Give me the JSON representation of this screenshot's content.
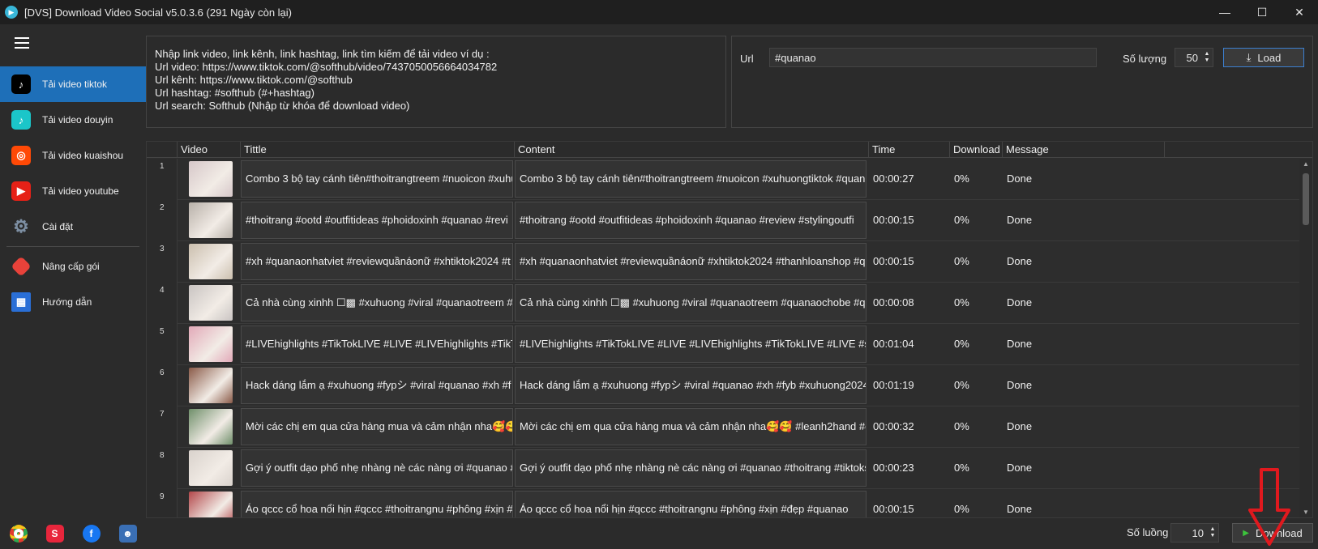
{
  "window": {
    "title": "[DVS] Download Video Social v5.0.3.6 (291 Ngày còn lại)"
  },
  "sidebar": {
    "items": [
      {
        "label": "Tải video tiktok",
        "icon": "tiktok-icon",
        "color": "#000000",
        "active": true
      },
      {
        "label": "Tải video douyin",
        "icon": "douyin-icon",
        "color": "#1bc6c9",
        "active": false
      },
      {
        "label": "Tải video kuaishou",
        "icon": "kuaishou-icon",
        "color": "#ff4906",
        "active": false
      },
      {
        "label": "Tải video youtube",
        "icon": "youtube-icon",
        "color": "#e62117",
        "active": false
      },
      {
        "label": "Cài đặt",
        "icon": "gear-icon",
        "color": "#5a6b7d",
        "active": false
      }
    ],
    "items2": [
      {
        "label": "Nâng cấp gói",
        "icon": "tag-icon",
        "color": "#e8423a"
      },
      {
        "label": "Hướng dẫn",
        "icon": "guide-icon",
        "color": "#2a6fd6"
      }
    ],
    "bottom_icons": [
      "chrome-icon",
      "shopee-video-icon",
      "facebook-icon",
      "support-agent-icon"
    ]
  },
  "info": {
    "lines": [
      "Nhập link video, link kênh, link hashtag, link tìm kiếm để tải video ví dụ :",
      "Url video: https://www.tiktok.com/@softhub/video/7437050056664034782",
      "Url kênh: https://www.tiktok.com/@softhub",
      "Url hashtag: #softhub (#+hashtag)",
      "Url search: Softhub (Nhập từ khóa để download video)"
    ]
  },
  "url_panel": {
    "url_label": "Url",
    "url_value": "#quanao",
    "qty_label": "Số lượng",
    "qty_value": "50",
    "load_label": "Load"
  },
  "grid": {
    "columns": [
      "Video",
      "Tittle",
      "Content",
      "Time",
      "Download",
      "Message"
    ],
    "rows": [
      {
        "n": "1",
        "title": "Combo 3 bộ tay cánh tiên#thoitrangtreem #nuoicon #xuhu",
        "content": "Combo 3 bộ tay cánh tiên#thoitrangtreem #nuoicon #xuhuongtiktok #quan",
        "time": "00:00:27",
        "download": "0%",
        "message": "Done",
        "thumb": "#d6c7c9"
      },
      {
        "n": "2",
        "title": "#thoitrang #ootd #outfitideas #phoidoxinh #quanao #revi",
        "content": "#thoitrang #ootd #outfitideas #phoidoxinh #quanao #review #stylingoutfi",
        "time": "00:00:15",
        "download": "0%",
        "message": "Done",
        "thumb": "#b8b1a9"
      },
      {
        "n": "3",
        "title": "#xh #quanaonhatviet #reviewquầnáonữ #xhtiktok2024 #t",
        "content": "#xh #quanaonhatviet #reviewquầnáonữ #xhtiktok2024 #thanhloanshop #q",
        "time": "00:00:15",
        "download": "0%",
        "message": "Done",
        "thumb": "#cbbfae"
      },
      {
        "n": "4",
        "title": "Cả nhà cùng xinhh ☐▩ #xuhuong #viral #quanaotreem #",
        "content": "Cả nhà cùng xinhh ☐▩ #xuhuong #viral #quanaotreem #quanaochobe #q",
        "time": "00:00:08",
        "download": "0%",
        "message": "Done",
        "thumb": "#c9c4c2"
      },
      {
        "n": "5",
        "title": "#LIVEhighlights #TikTokLIVE #LIVE #LIVEhighlights #TikT",
        "content": "#LIVEhighlights #TikTokLIVE #LIVE #LIVEhighlights #TikTokLIVE #LIVE #s",
        "time": "00:01:04",
        "download": "0%",
        "message": "Done",
        "thumb": "#e2a9b8"
      },
      {
        "n": "6",
        "title": "Hack dáng lắm ạ #xuhuong #fypシ #viral #quanao #xh #f",
        "content": "Hack dáng lắm ạ #xuhuong #fypシ #viral #quanao #xh #fyb #xuhuong2024",
        "time": "00:01:19",
        "download": "0%",
        "message": "Done",
        "thumb": "#8a5a48"
      },
      {
        "n": "7",
        "title": "Mời các chị em qua cửa hàng mua và cảm nhận nha🥰🥰",
        "content": "Mời các chị em qua cửa hàng mua và cảm nhận nha🥰🥰  #leanh2hand #q",
        "time": "00:00:32",
        "download": "0%",
        "message": "Done",
        "thumb": "#6f8f6a"
      },
      {
        "n": "8",
        "title": "Gợi ý outfit dạo phố nhẹ nhàng nè các nàng ơi #quanao #t",
        "content": "Gợi ý outfit dạo phố nhẹ nhàng nè các nàng ơi #quanao #thoitrang #tiktoks",
        "time": "00:00:23",
        "download": "0%",
        "message": "Done",
        "thumb": "#d9d2cc"
      },
      {
        "n": "9",
        "title": "Áo qccc cổ hoa nổi hịn #qccc #thoitrangnu #phông #xịn #",
        "content": "Áo qccc cổ hoa nổi hịn #qccc #thoitrangnu #phông #xịn #đẹp #quanao",
        "time": "00:00:15",
        "download": "0%",
        "message": "Done",
        "thumb": "#b3474a"
      }
    ]
  },
  "footer": {
    "threads_label": "Số luồng",
    "threads_value": "10",
    "download_label": "Download"
  },
  "colors": {
    "accent": "#1e6fb8",
    "annotation_arrow": "#e0191e"
  }
}
